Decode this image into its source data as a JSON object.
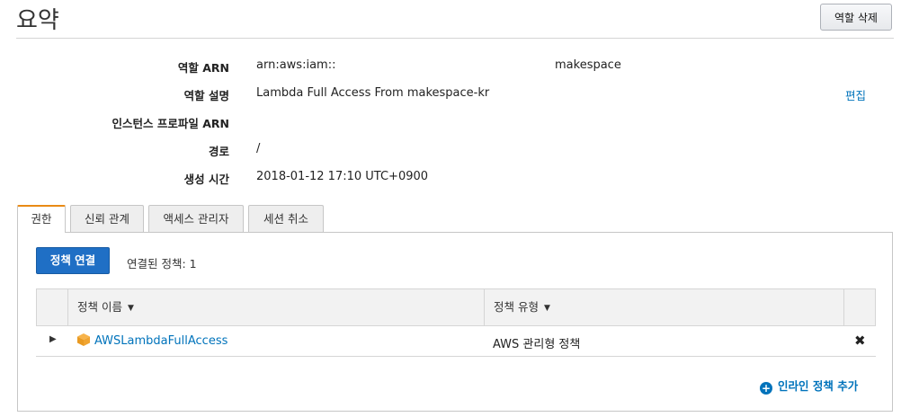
{
  "header": {
    "title": "요약",
    "delete_role_label": "역할 삭제"
  },
  "summary": {
    "arn": {
      "label": "역할 ARN",
      "value": "arn:aws:iam::",
      "suffix": "makespace"
    },
    "description": {
      "label": "역할 설명",
      "value": "Lambda Full Access From makespace-kr",
      "edit_label": "편집"
    },
    "instance_profile": {
      "label": "인스턴스 프로파일 ARN",
      "value": ""
    },
    "path": {
      "label": "경로",
      "value": "/"
    },
    "created": {
      "label": "생성 시간",
      "value": "2018-01-12 17:10 UTC+0900"
    }
  },
  "tabs": [
    {
      "label": "권한",
      "active": true
    },
    {
      "label": "신뢰 관계",
      "active": false
    },
    {
      "label": "액세스 관리자",
      "active": false
    },
    {
      "label": "세션 취소",
      "active": false
    }
  ],
  "permissions": {
    "attach_button_label": "정책 연결",
    "attached_count_label": "연결된 정책: 1",
    "columns": {
      "name": "정책 이름",
      "type": "정책 유형"
    },
    "rows": [
      {
        "name": "AWSLambdaFullAccess",
        "type": "AWS 관리형 정책",
        "icon": "policy-cube-icon"
      }
    ],
    "add_inline_label": "인라인 정책 추가"
  },
  "colors": {
    "primary_button": "#1f6fc5",
    "link": "#0073bb",
    "active_tab_accent": "#e98a15"
  }
}
